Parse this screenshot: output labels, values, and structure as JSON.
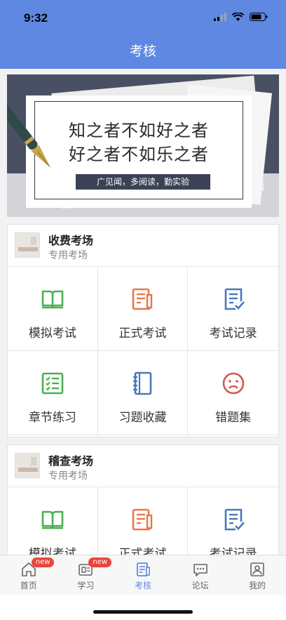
{
  "status": {
    "time": "9:32"
  },
  "header": {
    "title": "考核"
  },
  "banner": {
    "line1": "知之者不如好之者",
    "line2": "好之者不如乐之者",
    "motto": "广见闻，多阅读，勤实验"
  },
  "sections": [
    {
      "title": "收费考场",
      "subtitle": "专用考场",
      "items": [
        {
          "label": "模拟考试",
          "icon": "book-icon",
          "color": "#4caf50"
        },
        {
          "label": "正式考试",
          "icon": "exam-edit-icon",
          "color": "#e8784a"
        },
        {
          "label": "考试记录",
          "icon": "record-check-icon",
          "color": "#4a78b8"
        },
        {
          "label": "章节练习",
          "icon": "checklist-icon",
          "color": "#4caf50"
        },
        {
          "label": "习题收藏",
          "icon": "notebook-icon",
          "color": "#4a78b8"
        },
        {
          "label": "错题集",
          "icon": "sad-face-icon",
          "color": "#d9534f"
        }
      ]
    },
    {
      "title": "稽查考场",
      "subtitle": "专用考场",
      "items": [
        {
          "label": "模拟考试",
          "icon": "book-icon",
          "color": "#4caf50"
        },
        {
          "label": "正式考试",
          "icon": "exam-edit-icon",
          "color": "#e8784a"
        },
        {
          "label": "考试记录",
          "icon": "record-check-icon",
          "color": "#4a78b8"
        }
      ]
    }
  ],
  "tabbar": {
    "items": [
      {
        "label": "首页",
        "icon": "home-icon",
        "badge": "new"
      },
      {
        "label": "学习",
        "icon": "study-icon",
        "badge": "new"
      },
      {
        "label": "考核",
        "icon": "exam-icon",
        "active": true
      },
      {
        "label": "论坛",
        "icon": "chat-icon"
      },
      {
        "label": "我的",
        "icon": "profile-icon"
      }
    ]
  },
  "colors": {
    "primary": "#5f88e3",
    "badge": "#e9453d"
  }
}
